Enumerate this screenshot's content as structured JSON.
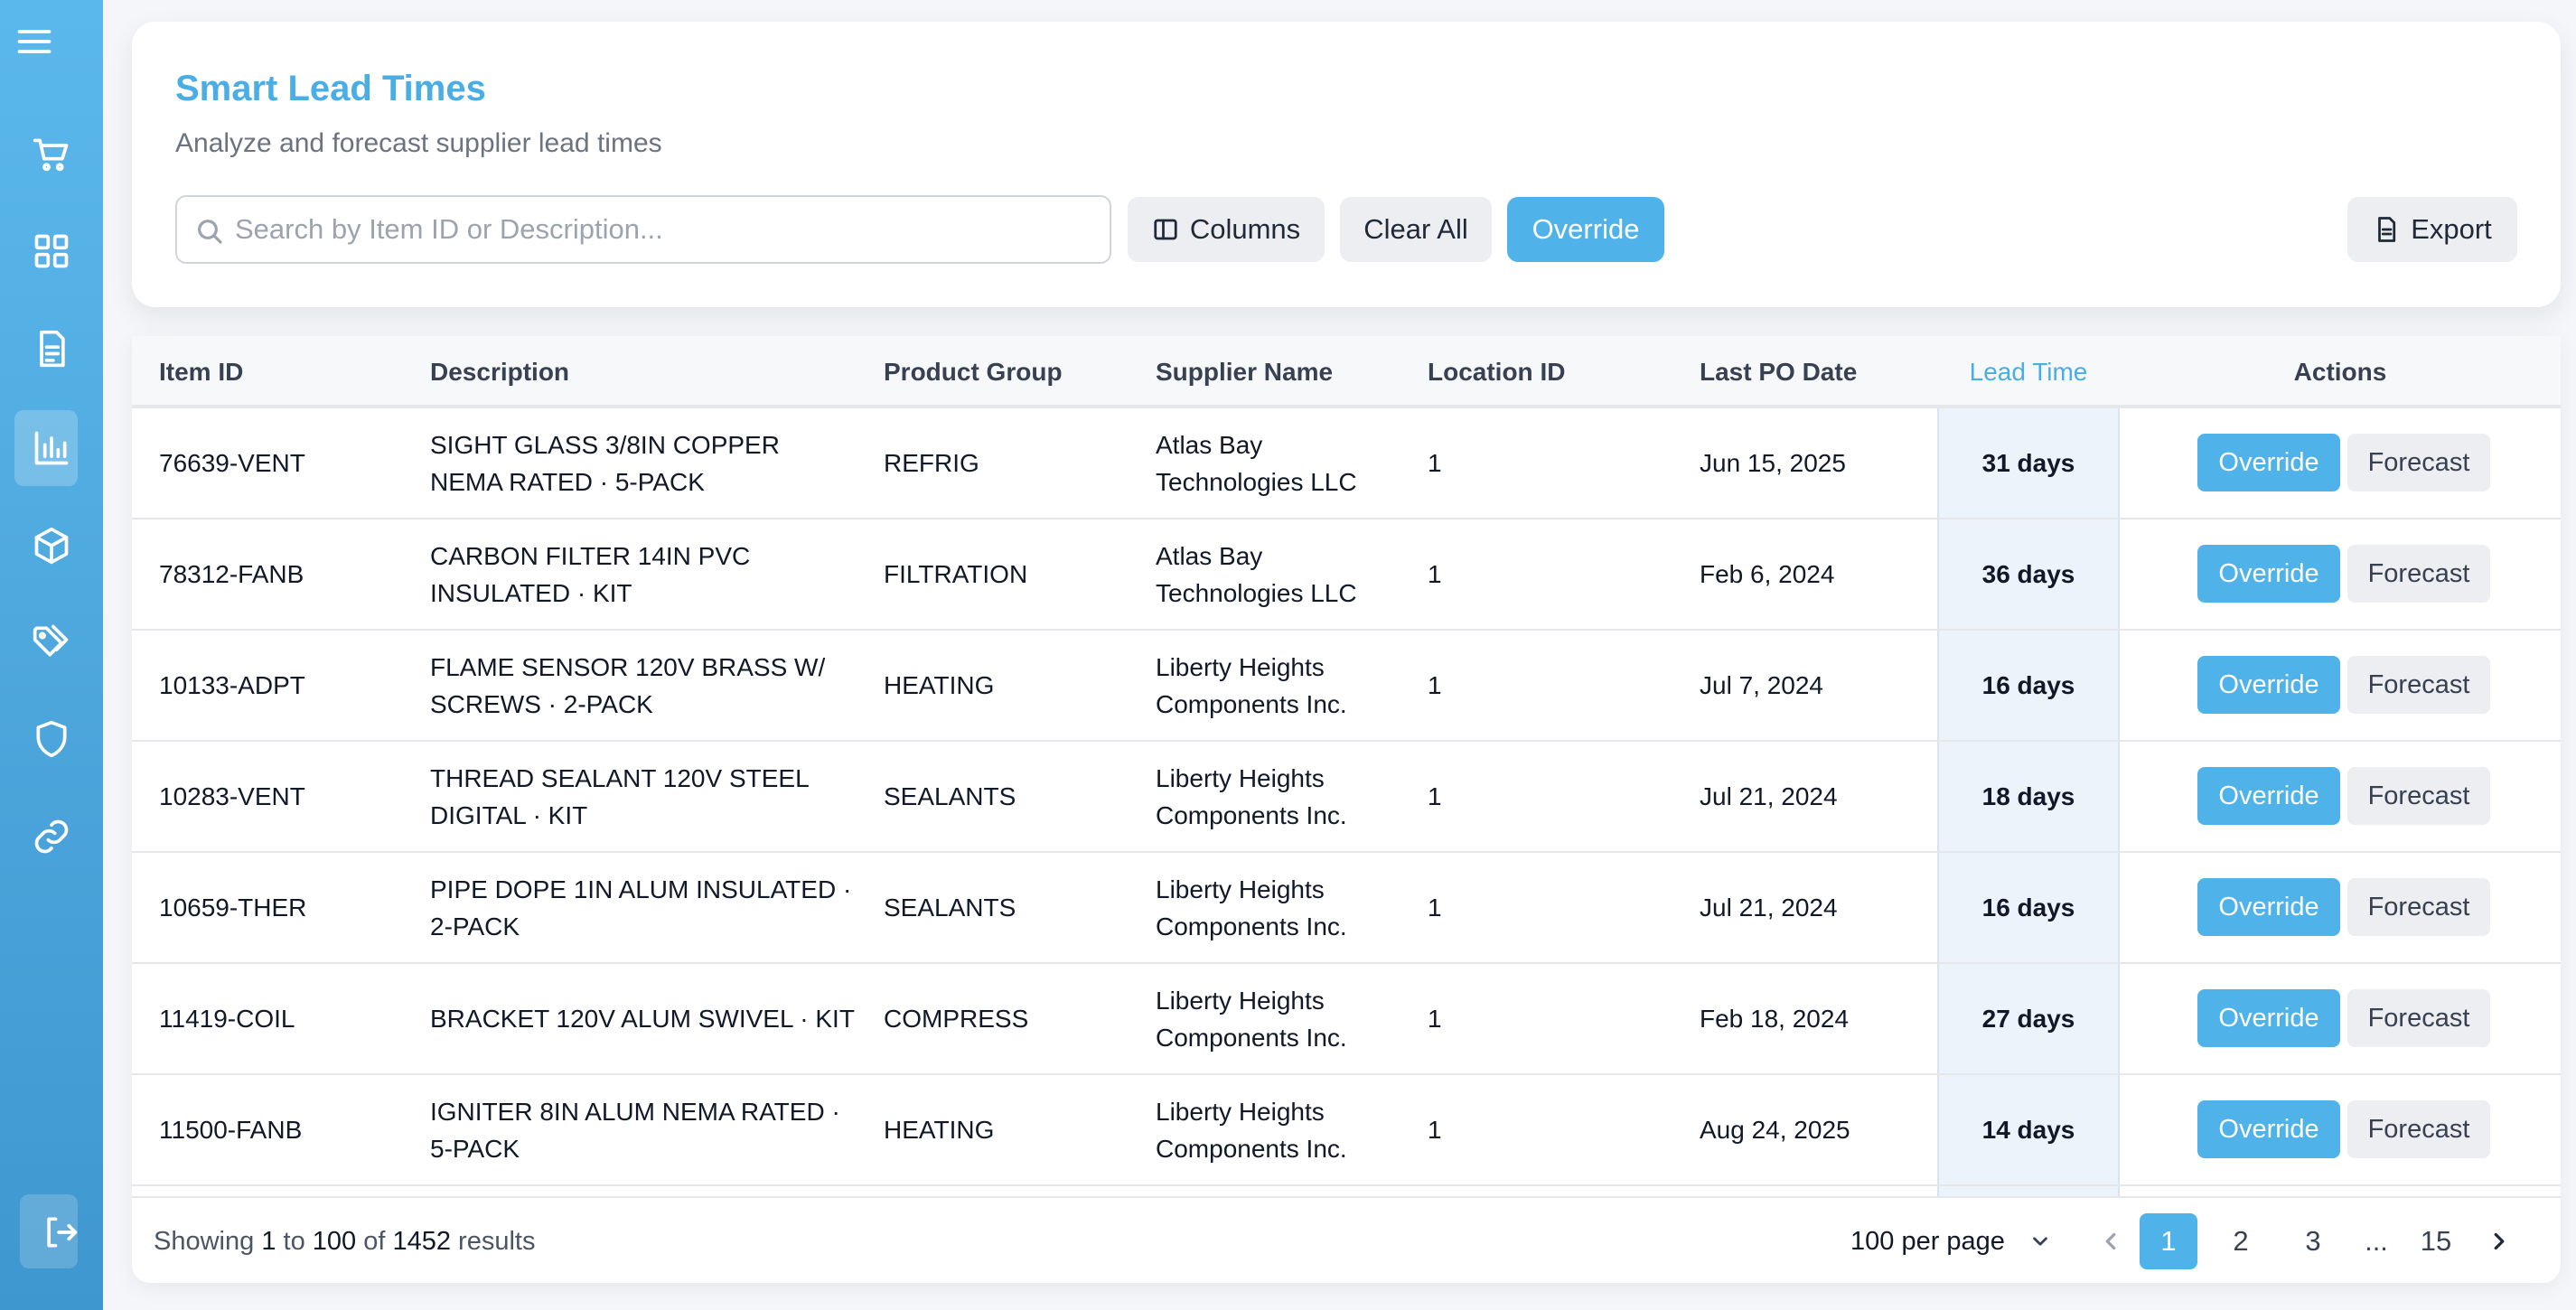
{
  "sidebar": {
    "icons": [
      "menu-icon",
      "cart-icon",
      "grid-icon",
      "document-icon",
      "bar-chart-icon",
      "box-icon",
      "tags-icon",
      "shield-icon",
      "link-icon",
      "logout-icon"
    ],
    "active": "bar-chart-icon"
  },
  "header": {
    "title": "Smart Lead Times",
    "subtitle": "Analyze and forecast supplier lead times"
  },
  "toolbar": {
    "search_placeholder": "Search by Item ID or Description...",
    "search_value": "",
    "columns_label": "Columns",
    "clear_label": "Clear All",
    "override_label": "Override",
    "export_label": "Export"
  },
  "table": {
    "headers": {
      "item_id": "Item ID",
      "description": "Description",
      "product_group": "Product Group",
      "supplier": "Supplier Name",
      "location": "Location ID",
      "last_po": "Last PO Date",
      "lead_time": "Lead Time",
      "actions": "Actions"
    },
    "action_labels": {
      "override": "Override",
      "forecast": "Forecast"
    },
    "rows": [
      {
        "item_id": "76639-VENT",
        "description": "SIGHT GLASS 3/8IN COPPER NEMA RATED · 5-PACK",
        "product_group": "REFRIG",
        "supplier": "Atlas Bay Technologies LLC",
        "location": "1",
        "last_po": "Jun 15, 2025",
        "lead_time": "31 days"
      },
      {
        "item_id": "78312-FANB",
        "description": "CARBON FILTER 14IN PVC INSULATED · KIT",
        "product_group": "FILTRATION",
        "supplier": "Atlas Bay Technologies LLC",
        "location": "1",
        "last_po": "Feb 6, 2024",
        "lead_time": "36 days"
      },
      {
        "item_id": "10133-ADPT",
        "description": "FLAME SENSOR 120V BRASS W/ SCREWS · 2-PACK",
        "product_group": "HEATING",
        "supplier": "Liberty Heights Components Inc.",
        "location": "1",
        "last_po": "Jul 7, 2024",
        "lead_time": "16 days"
      },
      {
        "item_id": "10283-VENT",
        "description": "THREAD SEALANT 120V STEEL DIGITAL · KIT",
        "product_group": "SEALANTS",
        "supplier": "Liberty Heights Components Inc.",
        "location": "1",
        "last_po": "Jul 21, 2024",
        "lead_time": "18 days"
      },
      {
        "item_id": "10659-THER",
        "description": "PIPE DOPE 1IN ALUM INSULATED · 2-PACK",
        "product_group": "SEALANTS",
        "supplier": "Liberty Heights Components Inc.",
        "location": "1",
        "last_po": "Jul 21, 2024",
        "lead_time": "16 days"
      },
      {
        "item_id": "11419-COIL",
        "description": "BRACKET 120V ALUM SWIVEL · KIT",
        "product_group": "COMPRESS",
        "supplier": "Liberty Heights Components Inc.",
        "location": "1",
        "last_po": "Feb 18, 2024",
        "lead_time": "27 days"
      },
      {
        "item_id": "11500-FANB",
        "description": "IGNITER 8IN ALUM NEMA RATED · 5-PACK",
        "product_group": "HEATING",
        "supplier": "Liberty Heights Components Inc.",
        "location": "1",
        "last_po": "Aug 24, 2025",
        "lead_time": "14 days"
      }
    ]
  },
  "footer": {
    "showing_prefix": "Showing",
    "from": "1",
    "to_word": "to",
    "to": "100",
    "of_word": "of",
    "total": "1452",
    "results_word": "results",
    "per_page": "100 per page",
    "pages": [
      "1",
      "2",
      "3",
      "...",
      "15"
    ],
    "current_page": "1"
  }
}
